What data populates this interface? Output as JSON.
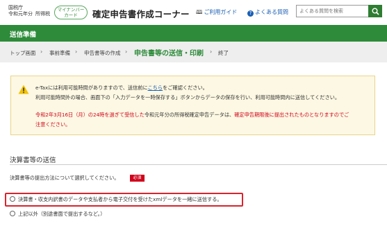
{
  "header": {
    "agency_line1": "国税庁",
    "agency_line2a": "令和元年分",
    "agency_line2b": "所得税",
    "mynumber_badge_line1": "マイナンバー",
    "mynumber_badge_line2": "カード",
    "site_title": "確定申告書作成コーナー",
    "guide_link": "ご利用ガイド",
    "faq_link": "よくある質問",
    "search_placeholder": "よくある質問を検索",
    "accent_color": "#2d8b3a"
  },
  "banner": {
    "title": "送信準備"
  },
  "breadcrumb": {
    "items": [
      "トップ画面",
      "事前準備",
      "申告書等の作成",
      "申告書等の送信・印刷",
      "終了"
    ],
    "active_index": 3
  },
  "notice": {
    "line1_before": "e-Taxには利用可能時間がありますので、送信前に",
    "line1_link": "こちら",
    "line1_after": "をご確認ください。",
    "line2": "利用可能時間外の場合、画面下の「入力データを一時保存する」ボタンからデータの保存を行い、利用可能時間内に送信してください。",
    "line3a": "令和2年3月16日（月）の24時を過ぎて受信した",
    "line3b": "令和元年分の所得税確定申告データは、",
    "line3c": "確定申告期限後に提出されたものとなりますのでご",
    "line4": "注意ください。"
  },
  "section": {
    "title": "決算書等の送信",
    "question": "決算書等の提出方法について選択してください。",
    "required_badge": "必須",
    "options": [
      "決算書・収支内訳書のデータや支払者から電子交付を受けたxmlデータを一緒に送信する。",
      "上記以外（別途書面で提出するなど。）"
    ]
  }
}
